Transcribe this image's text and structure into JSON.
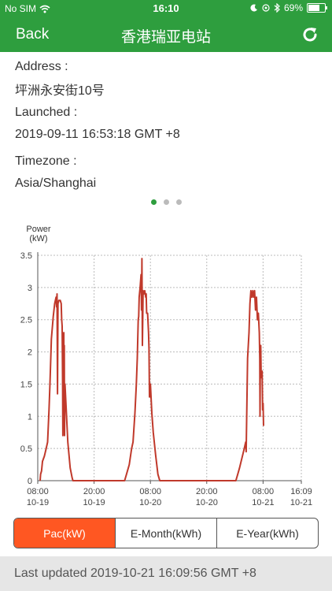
{
  "status_bar": {
    "carrier": "No SIM",
    "time": "16:10",
    "battery": "69%",
    "battery_level": 0.69
  },
  "nav": {
    "back_label": "Back",
    "title": "香港瑞亚电站",
    "refresh_icon": "refresh-icon"
  },
  "info": {
    "address_label": "Address :",
    "address_value": "坪洲永安街10号",
    "launched_label": "Launched :",
    "launched_value": "2019-09-11 16:53:18 GMT +8",
    "timezone_label": "Timezone :",
    "timezone_value": "Asia/Shanghai"
  },
  "pager": {
    "count": 3,
    "active": 0
  },
  "chart_data": {
    "type": "line",
    "ylabel_line1": "Power",
    "ylabel_line2": "(kW)",
    "ylim": [
      0,
      3.5
    ],
    "yticks": [
      "0",
      "0.5",
      "1",
      "1.5",
      "2",
      "2.5",
      "3",
      "3.5"
    ],
    "xticks": [
      {
        "t": 0,
        "time": "08:00",
        "date": "10-19"
      },
      {
        "t": 12,
        "time": "20:00",
        "date": "10-19"
      },
      {
        "t": 24,
        "time": "08:00",
        "date": "10-20"
      },
      {
        "t": 36,
        "time": "20:00",
        "date": "10-20"
      },
      {
        "t": 48,
        "time": "08:00",
        "date": "10-21"
      },
      {
        "t": 56.15,
        "time": "16:09",
        "date": "10-21"
      }
    ],
    "xrange_hours": [
      0,
      56.15
    ],
    "grid": true,
    "color": "#c0392b",
    "series": [
      {
        "points": [
          [
            0.5,
            0
          ],
          [
            0.6,
            0.1
          ],
          [
            0.8,
            0.15
          ],
          [
            1.0,
            0.3
          ],
          [
            1.4,
            0.38
          ],
          [
            1.8,
            0.5
          ],
          [
            2.1,
            0.6
          ],
          [
            2.4,
            1.1
          ],
          [
            2.6,
            1.5
          ],
          [
            2.9,
            2.2
          ],
          [
            3.3,
            2.55
          ],
          [
            3.6,
            2.75
          ],
          [
            3.9,
            2.85
          ],
          [
            4.0,
            2.7
          ],
          [
            4.1,
            2.9
          ],
          [
            4.2,
            1.35
          ],
          [
            4.3,
            2.75
          ],
          [
            4.5,
            2.8
          ],
          [
            4.8,
            2.8
          ],
          [
            5.0,
            2.75
          ],
          [
            5.1,
            2.5
          ],
          [
            5.2,
            2.4
          ],
          [
            5.3,
            1.5
          ],
          [
            5.35,
            0.7
          ],
          [
            5.4,
            1.1
          ],
          [
            5.5,
            1.0
          ],
          [
            5.55,
            2.3
          ],
          [
            5.6,
            0.85
          ],
          [
            5.65,
            2.1
          ],
          [
            5.7,
            0.7
          ],
          [
            5.8,
            1.5
          ],
          [
            6.0,
            1.2
          ],
          [
            6.4,
            0.6
          ],
          [
            6.9,
            0.2
          ],
          [
            7.3,
            0.05
          ],
          [
            7.5,
            0
          ],
          [
            18.5,
            0
          ],
          [
            18.9,
            0.1
          ],
          [
            19.5,
            0.25
          ],
          [
            20.0,
            0.5
          ],
          [
            20.3,
            0.6
          ],
          [
            20.7,
            1.05
          ],
          [
            21.0,
            1.5
          ],
          [
            21.2,
            1.9
          ],
          [
            21.4,
            2.5
          ],
          [
            21.5,
            2.55
          ],
          [
            21.6,
            2.85
          ],
          [
            21.8,
            3.0
          ],
          [
            22.0,
            3.2
          ],
          [
            22.1,
            2.65
          ],
          [
            22.2,
            3.45
          ],
          [
            22.3,
            2.1
          ],
          [
            22.45,
            2.95
          ],
          [
            22.6,
            2.9
          ],
          [
            22.8,
            2.95
          ],
          [
            23.0,
            2.85
          ],
          [
            23.1,
            2.9
          ],
          [
            23.2,
            2.6
          ],
          [
            23.4,
            2.6
          ],
          [
            23.6,
            2.3
          ],
          [
            23.7,
            2.05
          ],
          [
            23.8,
            1.3
          ],
          [
            24.0,
            1.5
          ],
          [
            24.3,
            1.05
          ],
          [
            24.6,
            0.75
          ],
          [
            25.1,
            0.4
          ],
          [
            25.6,
            0.1
          ],
          [
            26.0,
            0
          ],
          [
            42.2,
            0
          ],
          [
            42.6,
            0.1
          ],
          [
            43.0,
            0.2
          ],
          [
            43.5,
            0.35
          ],
          [
            44.0,
            0.5
          ],
          [
            44.3,
            0.6
          ],
          [
            44.4,
            0.45
          ],
          [
            44.7,
            1.9
          ],
          [
            45.0,
            2.3
          ],
          [
            45.2,
            2.75
          ],
          [
            45.4,
            2.95
          ],
          [
            45.6,
            2.85
          ],
          [
            45.8,
            2.95
          ],
          [
            46.0,
            2.85
          ],
          [
            46.2,
            2.95
          ],
          [
            46.4,
            2.65
          ],
          [
            46.6,
            2.85
          ],
          [
            46.8,
            2.5
          ],
          [
            47.0,
            2.6
          ],
          [
            47.2,
            2.3
          ],
          [
            47.3,
            1.9
          ],
          [
            47.35,
            1.0
          ],
          [
            47.4,
            1.7
          ],
          [
            47.5,
            2.1
          ],
          [
            47.6,
            1.6
          ],
          [
            47.8,
            1.7
          ],
          [
            47.9,
            1.1
          ],
          [
            48.0,
            1.2
          ],
          [
            48.1,
            0.85
          ]
        ]
      }
    ]
  },
  "tabs": [
    {
      "label": "Pac(kW)",
      "active": true
    },
    {
      "label": "E-Month(kWh)",
      "active": false
    },
    {
      "label": "E-Year(kWh)",
      "active": false
    }
  ],
  "footer": {
    "last_updated": "Last updated 2019-10-21 16:09:56 GMT +8"
  }
}
